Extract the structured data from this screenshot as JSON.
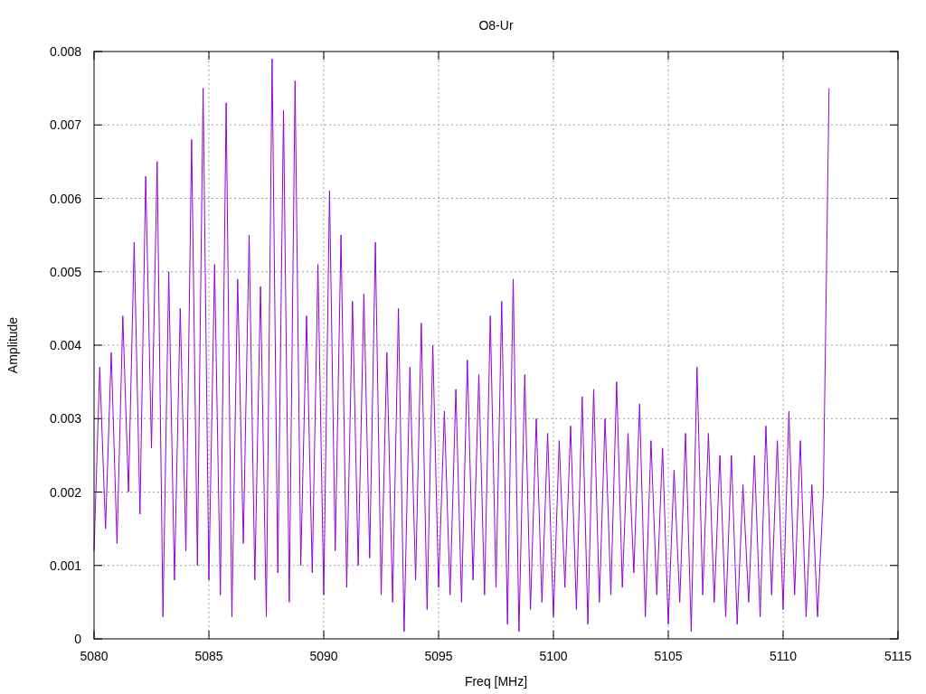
{
  "chart_data": {
    "type": "line",
    "title": "O8-Ur",
    "xlabel": "Freq [MHz]",
    "ylabel": "Amplitude",
    "grid": true,
    "xlim": [
      5080,
      5115
    ],
    "ylim": [
      0,
      0.008
    ],
    "xticks": [
      5080,
      5085,
      5090,
      5095,
      5100,
      5105,
      5110,
      5115
    ],
    "yticks": [
      0,
      0.001,
      0.002,
      0.003,
      0.004,
      0.005,
      0.006,
      0.007,
      0.008
    ],
    "x": [
      5080,
      5080.25,
      5080.5,
      5080.75,
      5081,
      5081.25,
      5081.5,
      5081.75,
      5082,
      5082.25,
      5082.5,
      5082.75,
      5083,
      5083.25,
      5083.5,
      5083.75,
      5084,
      5084.25,
      5084.5,
      5084.75,
      5085,
      5085.25,
      5085.5,
      5085.75,
      5086,
      5086.25,
      5086.5,
      5086.75,
      5087,
      5087.25,
      5087.5,
      5087.75,
      5088,
      5088.25,
      5088.5,
      5088.75,
      5089,
      5089.25,
      5089.5,
      5089.75,
      5090,
      5090.25,
      5090.5,
      5090.75,
      5091,
      5091.25,
      5091.5,
      5091.75,
      5092,
      5092.25,
      5092.5,
      5092.75,
      5093,
      5093.25,
      5093.5,
      5093.75,
      5094,
      5094.25,
      5094.5,
      5094.75,
      5095,
      5095.25,
      5095.5,
      5095.75,
      5096,
      5096.25,
      5096.5,
      5096.75,
      5097,
      5097.25,
      5097.5,
      5097.75,
      5098,
      5098.25,
      5098.5,
      5098.75,
      5099,
      5099.25,
      5099.5,
      5099.75,
      5100,
      5100.25,
      5100.5,
      5100.75,
      5101,
      5101.25,
      5101.5,
      5101.75,
      5102,
      5102.25,
      5102.5,
      5102.75,
      5103,
      5103.25,
      5103.5,
      5103.75,
      5104,
      5104.25,
      5104.5,
      5104.75,
      5105,
      5105.25,
      5105.5,
      5105.75,
      5106,
      5106.25,
      5106.5,
      5106.75,
      5107,
      5107.25,
      5107.5,
      5107.75,
      5108,
      5108.25,
      5108.5,
      5108.75,
      5109,
      5109.25,
      5109.5,
      5109.75,
      5110,
      5110.25,
      5110.5,
      5110.75,
      5111,
      5111.25,
      5111.5,
      5111.75,
      5112
    ],
    "series": [
      {
        "color": "#9400d3",
        "values": [
          0.0012,
          0.0037,
          0.0015,
          0.0039,
          0.0013,
          0.0044,
          0.002,
          0.0054,
          0.0017,
          0.0063,
          0.0026,
          0.0065,
          0.0003,
          0.005,
          0.0008,
          0.0045,
          0.0012,
          0.0068,
          0.001,
          0.0075,
          0.0008,
          0.0051,
          0.0006,
          0.0073,
          0.0003,
          0.0049,
          0.0013,
          0.0055,
          0.0008,
          0.0048,
          0.0003,
          0.0079,
          0.0009,
          0.0072,
          0.0005,
          0.0076,
          0.001,
          0.0044,
          0.0009,
          0.0051,
          0.0006,
          0.0061,
          0.0012,
          0.0055,
          0.0007,
          0.0046,
          0.001,
          0.0047,
          0.0011,
          0.0054,
          0.0006,
          0.0039,
          0.0005,
          0.0045,
          0.0001,
          0.0037,
          0.0008,
          0.0043,
          0.0004,
          0.004,
          0.0007,
          0.0031,
          0.0006,
          0.0034,
          0.0005,
          0.0038,
          0.0008,
          0.0036,
          0.0006,
          0.0044,
          0.0007,
          0.0046,
          0.0002,
          0.0049,
          0.0001,
          0.0036,
          0.0004,
          0.003,
          0.0005,
          0.0028,
          0.0003,
          0.0027,
          0.0007,
          0.0029,
          0.0004,
          0.0033,
          0.0002,
          0.0034,
          0.0005,
          0.003,
          0.0006,
          0.0035,
          0.0007,
          0.0028,
          0.0009,
          0.0032,
          0.0003,
          0.0027,
          0.0006,
          0.0026,
          0.0002,
          0.0023,
          0.0005,
          0.0028,
          0.0001,
          0.0037,
          0.0006,
          0.0028,
          0.0005,
          0.0025,
          0.0003,
          0.0025,
          0.0002,
          0.0021,
          0.0005,
          0.0025,
          0.0003,
          0.0029,
          0.0006,
          0.0027,
          0.0004,
          0.0031,
          0.0006,
          0.0027,
          0.0003,
          0.0021,
          0.0003,
          0.002,
          0.0075
        ]
      }
    ]
  }
}
